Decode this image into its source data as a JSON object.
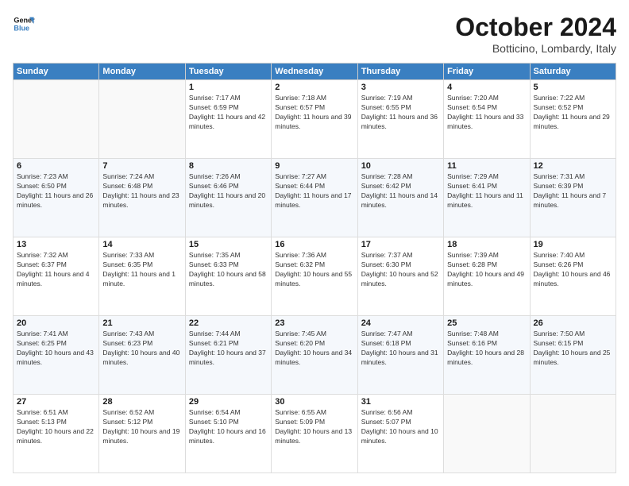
{
  "logo": {
    "line1": "General",
    "line2": "Blue"
  },
  "title": "October 2024",
  "subtitle": "Botticino, Lombardy, Italy",
  "days_header": [
    "Sunday",
    "Monday",
    "Tuesday",
    "Wednesday",
    "Thursday",
    "Friday",
    "Saturday"
  ],
  "weeks": [
    [
      {
        "day": "",
        "info": ""
      },
      {
        "day": "",
        "info": ""
      },
      {
        "day": "1",
        "info": "Sunrise: 7:17 AM\nSunset: 6:59 PM\nDaylight: 11 hours and 42 minutes."
      },
      {
        "day": "2",
        "info": "Sunrise: 7:18 AM\nSunset: 6:57 PM\nDaylight: 11 hours and 39 minutes."
      },
      {
        "day": "3",
        "info": "Sunrise: 7:19 AM\nSunset: 6:55 PM\nDaylight: 11 hours and 36 minutes."
      },
      {
        "day": "4",
        "info": "Sunrise: 7:20 AM\nSunset: 6:54 PM\nDaylight: 11 hours and 33 minutes."
      },
      {
        "day": "5",
        "info": "Sunrise: 7:22 AM\nSunset: 6:52 PM\nDaylight: 11 hours and 29 minutes."
      }
    ],
    [
      {
        "day": "6",
        "info": "Sunrise: 7:23 AM\nSunset: 6:50 PM\nDaylight: 11 hours and 26 minutes."
      },
      {
        "day": "7",
        "info": "Sunrise: 7:24 AM\nSunset: 6:48 PM\nDaylight: 11 hours and 23 minutes."
      },
      {
        "day": "8",
        "info": "Sunrise: 7:26 AM\nSunset: 6:46 PM\nDaylight: 11 hours and 20 minutes."
      },
      {
        "day": "9",
        "info": "Sunrise: 7:27 AM\nSunset: 6:44 PM\nDaylight: 11 hours and 17 minutes."
      },
      {
        "day": "10",
        "info": "Sunrise: 7:28 AM\nSunset: 6:42 PM\nDaylight: 11 hours and 14 minutes."
      },
      {
        "day": "11",
        "info": "Sunrise: 7:29 AM\nSunset: 6:41 PM\nDaylight: 11 hours and 11 minutes."
      },
      {
        "day": "12",
        "info": "Sunrise: 7:31 AM\nSunset: 6:39 PM\nDaylight: 11 hours and 7 minutes."
      }
    ],
    [
      {
        "day": "13",
        "info": "Sunrise: 7:32 AM\nSunset: 6:37 PM\nDaylight: 11 hours and 4 minutes."
      },
      {
        "day": "14",
        "info": "Sunrise: 7:33 AM\nSunset: 6:35 PM\nDaylight: 11 hours and 1 minute."
      },
      {
        "day": "15",
        "info": "Sunrise: 7:35 AM\nSunset: 6:33 PM\nDaylight: 10 hours and 58 minutes."
      },
      {
        "day": "16",
        "info": "Sunrise: 7:36 AM\nSunset: 6:32 PM\nDaylight: 10 hours and 55 minutes."
      },
      {
        "day": "17",
        "info": "Sunrise: 7:37 AM\nSunset: 6:30 PM\nDaylight: 10 hours and 52 minutes."
      },
      {
        "day": "18",
        "info": "Sunrise: 7:39 AM\nSunset: 6:28 PM\nDaylight: 10 hours and 49 minutes."
      },
      {
        "day": "19",
        "info": "Sunrise: 7:40 AM\nSunset: 6:26 PM\nDaylight: 10 hours and 46 minutes."
      }
    ],
    [
      {
        "day": "20",
        "info": "Sunrise: 7:41 AM\nSunset: 6:25 PM\nDaylight: 10 hours and 43 minutes."
      },
      {
        "day": "21",
        "info": "Sunrise: 7:43 AM\nSunset: 6:23 PM\nDaylight: 10 hours and 40 minutes."
      },
      {
        "day": "22",
        "info": "Sunrise: 7:44 AM\nSunset: 6:21 PM\nDaylight: 10 hours and 37 minutes."
      },
      {
        "day": "23",
        "info": "Sunrise: 7:45 AM\nSunset: 6:20 PM\nDaylight: 10 hours and 34 minutes."
      },
      {
        "day": "24",
        "info": "Sunrise: 7:47 AM\nSunset: 6:18 PM\nDaylight: 10 hours and 31 minutes."
      },
      {
        "day": "25",
        "info": "Sunrise: 7:48 AM\nSunset: 6:16 PM\nDaylight: 10 hours and 28 minutes."
      },
      {
        "day": "26",
        "info": "Sunrise: 7:50 AM\nSunset: 6:15 PM\nDaylight: 10 hours and 25 minutes."
      }
    ],
    [
      {
        "day": "27",
        "info": "Sunrise: 6:51 AM\nSunset: 5:13 PM\nDaylight: 10 hours and 22 minutes."
      },
      {
        "day": "28",
        "info": "Sunrise: 6:52 AM\nSunset: 5:12 PM\nDaylight: 10 hours and 19 minutes."
      },
      {
        "day": "29",
        "info": "Sunrise: 6:54 AM\nSunset: 5:10 PM\nDaylight: 10 hours and 16 minutes."
      },
      {
        "day": "30",
        "info": "Sunrise: 6:55 AM\nSunset: 5:09 PM\nDaylight: 10 hours and 13 minutes."
      },
      {
        "day": "31",
        "info": "Sunrise: 6:56 AM\nSunset: 5:07 PM\nDaylight: 10 hours and 10 minutes."
      },
      {
        "day": "",
        "info": ""
      },
      {
        "day": "",
        "info": ""
      }
    ]
  ]
}
